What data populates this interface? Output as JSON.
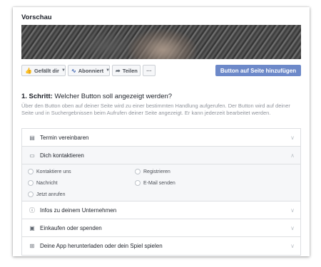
{
  "preview": {
    "title": "Vorschau"
  },
  "action_bar": {
    "like_label": "Gefällt dir",
    "subscribe_label": "Abonniert",
    "share_label": "Teilen",
    "more_label": "···",
    "add_button_label": "Button auf Seite hinzufügen"
  },
  "step": {
    "number": "1. Schritt:",
    "question": "Welcher Button soll angezeigt werden?",
    "description": "Über den Button oben auf deiner Seite wird zu einer bestimmten Handlung aufgerufen. Der Button wird auf deiner Seite und in Suchergebnissen beim Aufrufen deiner Seite angezeigt. Er kann jederzeit bearbeitet werden."
  },
  "categories": [
    {
      "label": "Termin vereinbaren",
      "icon": "calendar-icon"
    },
    {
      "label": "Dich kontaktieren",
      "icon": "chat-icon"
    },
    {
      "label": "Infos zu deinem Unternehmen",
      "icon": "info-icon"
    },
    {
      "label": "Einkaufen oder spenden",
      "icon": "shopping-bag-icon"
    },
    {
      "label": "Deine App herunterladen oder dein Spiel spielen",
      "icon": "download-icon"
    }
  ],
  "contact_options": [
    "Kontaktiere uns",
    "Registrieren",
    "Nachricht",
    "E-Mail senden",
    "Jetzt anrufen"
  ]
}
